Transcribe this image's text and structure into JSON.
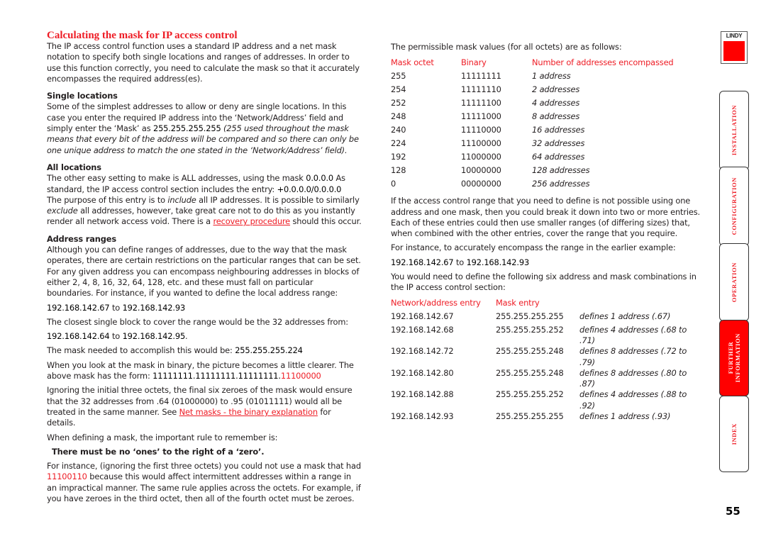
{
  "left": {
    "title": "Calculating the mask for IP access control",
    "intro": "The IP access control function uses a standard IP address and a net mask notation to specify both single locations and ranges of addresses. In order to use this function correctly, you need to calculate the mask so that it accurately encompasses the required address(es).",
    "single": {
      "heading": "Single locations",
      "text1": "Some of the simplest addresses to allow or deny are single locations. In this case you enter the required IP address into the ‘Network/Address’ field and simply enter the ‘Mask’ as ",
      "mask": "255.255.255.255",
      "italic": " (255 used throughout the mask means that every bit of the address will be compared and so there can only be one unique address to match the one stated in the ‘Network/Address’ field)."
    },
    "all": {
      "heading": "All locations",
      "text1": "The other easy setting to make is ALL addresses, using the mask ",
      "mask": "0.0.0.0",
      "text2": "  As standard, the IP access control section includes the entry: ",
      "entry": "+0.0.0.0/0.0.0.0",
      "text3": "The purpose of this entry is to ",
      "include": "include",
      "text4": " all IP addresses. It is possible to similarly ",
      "exclude": "exclude",
      "text5": " all addresses, however, take great care not to do this as you instantly render all network access void. There is a ",
      "link": "recovery procedure",
      "text6": " should this occur."
    },
    "ranges": {
      "heading": "Address ranges",
      "text1": "Although you can define ranges of addresses, due to the way that the mask operates, there are certain restrictions on the particular ranges that can be set. For any given address you can encompass neighbouring addresses in blocks of either 2, 4, 8, 16, 32, 64, 128, etc. and these must fall on particular boundaries. For instance, if you wanted to define the local address range:",
      "range_from": "192.168.142.67",
      "to": " to ",
      "range_to": "192.168.142.93",
      "text2": "The closest single block to cover the range would be the 32 addresses from:",
      "block_from": "192.168.142.64",
      "block_to": "192.168.142.95",
      "period": ".",
      "text3": "The mask needed to accomplish this would be: ",
      "mask": "255.255.255.224",
      "text4": "When you look at the mask in binary, the picture becomes a little clearer. The above mask has the form: ",
      "binary_black": "11111111.11111111.11111111.",
      "binary_red": "11100000",
      "text5": "Ignoring the initial three octets, the final six zeroes of the mask would ensure that the 32 addresses from .64 (01000000) to .95 (01011111) would all be treated in the same manner. See ",
      "link": "Net masks - the binary explanation",
      "text6": " for details.",
      "text7": "When defining a mask, the important rule to remember is:",
      "rule": "There must be no ‘ones’ to the right of a ‘zero’.",
      "text8": "For instance, (ignoring the first three octets) you could not use a mask that had ",
      "bad_mask": "11100110",
      "text9": " because this would affect intermittent addresses within a range in an impractical manner. The same rule applies across the octets. For example, if you have zeroes in the third octet, then all of the fourth octet must be zeroes."
    }
  },
  "right": {
    "intro": "The permissible mask values (for all octets) are as follows:",
    "mask_table": {
      "headers": [
        "Mask octet",
        "Binary",
        "Number of addresses encompassed"
      ],
      "rows": [
        [
          "255",
          "11111111",
          "1 address"
        ],
        [
          "254",
          "11111110",
          "2 addresses"
        ],
        [
          "252",
          "11111100",
          "4 addresses"
        ],
        [
          "248",
          "11111000",
          "8 addresses"
        ],
        [
          "240",
          "11110000",
          "16 addresses"
        ],
        [
          "224",
          "11100000",
          "32 addresses"
        ],
        [
          "192",
          "11000000",
          "64 addresses"
        ],
        [
          "128",
          "10000000",
          "128 addresses"
        ],
        [
          "0",
          "00000000",
          "256 addresses"
        ]
      ]
    },
    "para1": "If the access control range that you need to define is not possible using one address and one mask, then you could break it down into two or more entries. Each of these entries could then use smaller ranges (of differing sizes) that, when combined with the other entries, cover the range that you require.",
    "para2": "For instance, to accurately encompass the range in the earlier example:",
    "range_from": "192.168.142.67",
    "to": " to ",
    "range_to": "192.168.142.93",
    "para3": "You would need to define the following six address and mask combinations in the IP access control section:",
    "entry_table": {
      "headers": [
        "Network/address entry",
        "Mask entry",
        ""
      ],
      "rows": [
        [
          "192.168.142.67",
          "255.255.255.255",
          "defines 1 address (.67)"
        ],
        [
          "192.168.142.68",
          "255.255.255.252",
          "defines 4 addresses (.68 to .71)"
        ],
        [
          "192.168.142.72",
          "255.255.255.248",
          "defines 8 addresses (.72 to .79)"
        ],
        [
          "192.168.142.80",
          "255.255.255.248",
          "defines 8 addresses (.80 to .87)"
        ],
        [
          "192.168.142.88",
          "255.255.255.252",
          "defines 4 addresses (.88 to .92)"
        ],
        [
          "192.168.142.93",
          "255.255.255.255",
          "defines 1 address (.93)"
        ]
      ]
    }
  },
  "nav": {
    "logo": "LINDY",
    "tabs": [
      {
        "label": "INSTALLATION",
        "active": false
      },
      {
        "label": "CONFIGURATION",
        "active": false
      },
      {
        "label": "OPERATION",
        "active": false
      },
      {
        "label": "FURTHER\nINFORMATION",
        "active": true
      },
      {
        "label": "INDEX",
        "active": false
      }
    ]
  },
  "page_number": "55",
  "colors": {
    "accent": "#ee1c25",
    "tab_active": "#ff0000"
  }
}
